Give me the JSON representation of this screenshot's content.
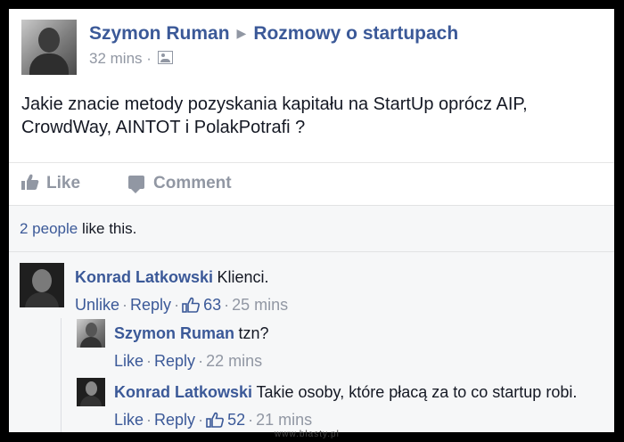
{
  "post": {
    "author": "Szymon Ruman",
    "group": "Rozmowy o startupach",
    "time": "32 mins",
    "separator": "·",
    "text": "Jakie znacie metody pozyskania kapitału na StartUp oprócz AIP, CrowdWay, AINTOT i PolakPotrafi ?"
  },
  "actions": {
    "like": "Like",
    "comment": "Comment"
  },
  "likes": {
    "people": "2 people",
    "suffix": " like this."
  },
  "comments": [
    {
      "author": "Konrad Latkowski",
      "text": "Klienci.",
      "action": "Unlike",
      "reply": "Reply",
      "likes": "63",
      "time": "25 mins"
    },
    {
      "author": "Szymon Ruman",
      "text": "tzn?",
      "action": "Like",
      "reply": "Reply",
      "time": "22 mins"
    },
    {
      "author": "Konrad Latkowski",
      "text": "Takie osoby, które płacą za to co startup robi.",
      "action": "Like",
      "reply": "Reply",
      "likes": "52",
      "time": "21 mins"
    }
  ],
  "watermark": "www.blasty.pl",
  "colors": {
    "link": "#3b5998",
    "muted": "#9197a3",
    "text": "#141823",
    "ufi_bg": "#f6f7f8"
  },
  "icons": [
    "audience-icon",
    "like-thumb-icon",
    "comment-bubble-icon"
  ]
}
